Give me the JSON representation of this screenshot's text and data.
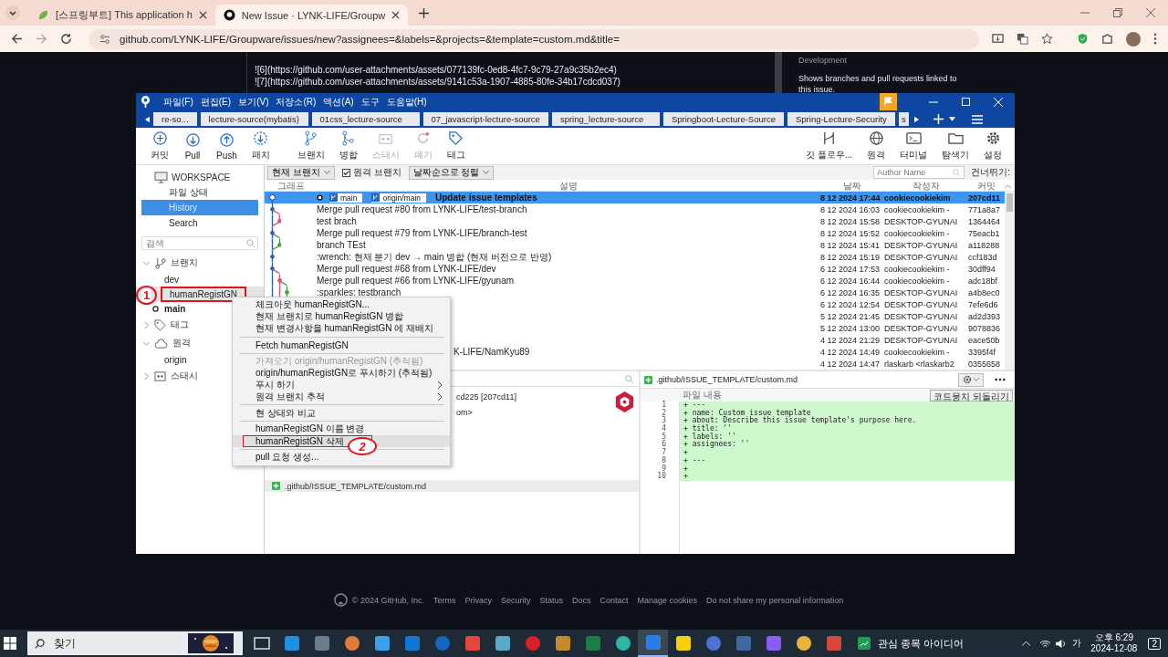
{
  "browser": {
    "tabs": [
      {
        "title": "[스프링부트] This application h",
        "selected": false
      },
      {
        "title": "New Issue · LYNK-LIFE/Groupw",
        "selected": true
      }
    ],
    "url": "github.com/LYNK-LIFE/Groupware/issues/new?assignees=&labels=&projects=&template=custom.md&title="
  },
  "page": {
    "lines": [
      "![6](https://github.com/user-attachments/assets/077139fc-0ed8-4fc7-9c79-27a9c35b2ec4)",
      "![7](https://github.com/user-attachments/assets/9141c53a-1907-4885-80fe-34b17cdcd037)"
    ],
    "sidebar_title": "Development",
    "sidebar_text": "Shows branches and pull requests linked to this issue.",
    "footer": {
      "copyright": "© 2024 GitHub, Inc.",
      "links": [
        "Terms",
        "Privacy",
        "Security",
        "Status",
        "Docs",
        "Contact",
        "Manage cookies",
        "Do not share my personal information"
      ]
    }
  },
  "app": {
    "menu": [
      "파일(F)",
      "편집(E)",
      "보기(V)",
      "저장소(R)",
      "액션(A)",
      "도구",
      "도움말(H)"
    ],
    "repo_tabs": [
      "re-so...",
      "lecture-source(mybatis)",
      "01css_lecture-source",
      "07_javascript-lecture-source",
      "spring_lecture-source",
      "Springboot-Lecture-Source",
      "Spring-Lecture-Security",
      "s"
    ],
    "toolbar_left": [
      {
        "label": "커밋",
        "disabled": false
      },
      {
        "label": "Pull",
        "disabled": false
      },
      {
        "label": "Push",
        "disabled": false
      },
      {
        "label": "패치",
        "disabled": false
      },
      {
        "label": "브랜치",
        "disabled": false
      },
      {
        "label": "병합",
        "disabled": false
      },
      {
        "label": "스태시",
        "disabled": true
      },
      {
        "label": "폐기",
        "disabled": true
      },
      {
        "label": "태그",
        "disabled": false
      }
    ],
    "toolbar_right": [
      {
        "label": "깃 플로우..."
      },
      {
        "label": "원격"
      },
      {
        "label": "터미널"
      },
      {
        "label": "탐색기"
      },
      {
        "label": "설정"
      }
    ],
    "sidebar": {
      "workspace": "WORKSPACE",
      "views": [
        {
          "label": "파일 상태",
          "selected": false
        },
        {
          "label": "History",
          "selected": true
        },
        {
          "label": "Search",
          "selected": false
        }
      ],
      "search_placeholder": "검색",
      "sections": [
        {
          "label": "브랜치",
          "expanded": true,
          "children": [
            {
              "label": "dev",
              "current": false,
              "highlighted": false,
              "annotated": false
            },
            {
              "label": "humanRegistGN",
              "current": false,
              "highlighted": true,
              "annotated": true
            },
            {
              "label": "main",
              "current": true,
              "highlighted": false,
              "annotated": false
            }
          ]
        },
        {
          "label": "태그",
          "expanded": false
        },
        {
          "label": "원격",
          "expanded": true,
          "children": [
            {
              "label": "origin",
              "current": false,
              "highlighted": false,
              "annotated": false
            }
          ]
        },
        {
          "label": "스태시",
          "expanded": false
        }
      ]
    },
    "filters": {
      "branch": "현재 브랜치",
      "remote": {
        "label": "원격 브랜치",
        "checked": true
      },
      "sort": "날짜순으로 정렬",
      "author_placeholder": "Author Name",
      "skip": "건너뛰기:"
    },
    "columns": [
      "그래프",
      "설명",
      "날짜",
      "작성자",
      "커밋"
    ],
    "commits": [
      {
        "refs": [
          "main",
          "origin/main"
        ],
        "message": "Update issue templates",
        "date": "8 12 2024 17:44",
        "author": "cookiecookiekim",
        "hash": "207cd11",
        "selected": true
      },
      {
        "message": "Merge pull request #80 from LYNK-LIFE/test-branch",
        "date": "8 12 2024 16:03",
        "author": "cookiecookiekim -",
        "hash": "771a8a7",
        "selected": false
      },
      {
        "message": "test brach",
        "date": "8 12 2024 15:58",
        "author": "DESKTOP-GYUNAI",
        "hash": "1364464",
        "selected": false
      },
      {
        "message": "Merge pull request #79 from LYNK-LIFE/branch-test",
        "date": "8 12 2024 15:52",
        "author": "cookiecookiekim -",
        "hash": "75eacb1",
        "selected": false
      },
      {
        "message": "branch TEst",
        "date": "8 12 2024 15:41",
        "author": "DESKTOP-GYUNAI",
        "hash": "a118288",
        "selected": false
      },
      {
        "message": ":wrench: 현재 분기 dev → main 병합 (현재 버전으로 반영)",
        "date": "8 12 2024 15:19",
        "author": "DESKTOP-GYUNAI",
        "hash": "ccf183d",
        "selected": false
      },
      {
        "message": "Merge pull request #68 from LYNK-LIFE/dev",
        "date": "6 12 2024 17:53",
        "author": "cookiecookiekim -",
        "hash": "30dff94",
        "selected": false
      },
      {
        "message": "Merge pull request #66 from LYNK-LIFE/gyunam",
        "date": "6 12 2024 16:44",
        "author": "cookiecookiekim -",
        "hash": "adc18bf",
        "selected": false
      },
      {
        "message": ":sparkles: testbranch",
        "date": "6 12 2024 16:35",
        "author": "DESKTOP-GYUNAI",
        "hash": "a4b8ec0",
        "selected": false
      },
      {
        "date": "6 12 2024 12:54",
        "author": "DESKTOP-GYUNAI",
        "hash": "7efe6d6",
        "selected": false
      },
      {
        "date": "5 12 2024 21:45",
        "author": "DESKTOP-GYUNAI",
        "hash": "ad2d393",
        "selected": false
      },
      {
        "date": "5 12 2024 13:00",
        "author": "DESKTOP-GYUNAI",
        "hash": "9078836",
        "selected": false
      },
      {
        "date": "4 12 2024 21:29",
        "author": "DESKTOP-GYUNAI",
        "hash": "eace50b",
        "selected": false
      },
      {
        "message": "K-LIFE/NamKyu89",
        "clipped": true,
        "date": "4 12 2024 14:49",
        "author": "cookiecookiekim -",
        "hash": "3395f4f",
        "selected": false
      },
      {
        "date": "4 12 2024 14:47",
        "author": "rlaskarb <rlaskarb2",
        "hash": "0355658",
        "selected": false
      }
    ],
    "commit_detail": [
      "cd225 [207cd11]",
      "om>"
    ],
    "files": [
      {
        "path": ".github/ISSUE_TEMPLATE/custom.md"
      }
    ],
    "diff": {
      "path": ".github/ISSUE_TEMPLATE/custom.md",
      "section": "파일 내용",
      "revert": "코드뭉치 되돌리기",
      "lines": [
        {
          "no": "1",
          "text": "+ ---"
        },
        {
          "no": "2",
          "text": "+ name: Custom issue template"
        },
        {
          "no": "3",
          "text": "+ about: Describe this issue template's purpose here."
        },
        {
          "no": "4",
          "text": "+ title: ''"
        },
        {
          "no": "5",
          "text": "+ labels: ''"
        },
        {
          "no": "6",
          "text": "+ assignees: ''"
        },
        {
          "no": "7",
          "text": "+"
        },
        {
          "no": "8",
          "text": "+ ---"
        },
        {
          "no": "9",
          "text": "+"
        },
        {
          "no": "10",
          "text": "+"
        }
      ]
    },
    "context_menu": [
      {
        "kind": "item",
        "label": "체크아웃 humanRegistGN...",
        "disabled": false,
        "submenu": false,
        "highlighted": false,
        "annotated": false
      },
      {
        "kind": "item",
        "label": "현재 브랜치로 humanRegistGN 병합",
        "disabled": false,
        "submenu": false,
        "highlighted": false,
        "annotated": false
      },
      {
        "kind": "item",
        "label": "현재 변경사항을 humanRegistGN 에 재배치",
        "disabled": false,
        "submenu": false,
        "highlighted": false,
        "annotated": false
      },
      {
        "kind": "separator"
      },
      {
        "kind": "item",
        "label": "Fetch humanRegistGN",
        "disabled": false,
        "submenu": false,
        "highlighted": false,
        "annotated": false
      },
      {
        "kind": "separator"
      },
      {
        "kind": "item",
        "label": "가져오기 origin/humanRegistGN (추적됨)",
        "disabled": true,
        "submenu": false,
        "highlighted": false,
        "annotated": false
      },
      {
        "kind": "item",
        "label": "origin/humanRegistGN로 푸시하기 (추적됨)",
        "disabled": false,
        "submenu": false,
        "highlighted": false,
        "annotated": false
      },
      {
        "kind": "item",
        "label": "푸시 하기",
        "disabled": false,
        "submenu": true,
        "highlighted": false,
        "annotated": false
      },
      {
        "kind": "item",
        "label": "원격 브랜치 추적",
        "disabled": false,
        "submenu": true,
        "highlighted": false,
        "annotated": false
      },
      {
        "kind": "separator"
      },
      {
        "kind": "item",
        "label": "현 상태와 비교",
        "disabled": false,
        "submenu": false,
        "highlighted": false,
        "annotated": false
      },
      {
        "kind": "separator"
      },
      {
        "kind": "item",
        "label": "humanRegistGN 이름 변경",
        "disabled": false,
        "submenu": false,
        "highlighted": false,
        "annotated": false
      },
      {
        "kind": "item",
        "label": "humanRegistGN 삭제",
        "disabled": false,
        "submenu": false,
        "highlighted": true,
        "annotated": true
      },
      {
        "kind": "separator"
      },
      {
        "kind": "item",
        "label": "pull 요청 생성...",
        "disabled": false,
        "submenu": false,
        "highlighted": false,
        "annotated": false
      }
    ],
    "annotations": [
      {
        "label": "1"
      },
      {
        "label": "2"
      }
    ]
  },
  "taskbar": {
    "search_placeholder": "찾기",
    "apps": [
      {
        "selected": false
      },
      {
        "selected": false
      },
      {
        "selected": false
      },
      {
        "selected": false
      },
      {
        "selected": false
      },
      {
        "selected": false
      },
      {
        "selected": false
      },
      {
        "selected": false
      },
      {
        "selected": false
      },
      {
        "selected": false
      },
      {
        "selected": false
      },
      {
        "selected": false
      },
      {
        "selected": false
      },
      {
        "selected": true
      },
      {
        "selected": false
      },
      {
        "selected": false
      },
      {
        "selected": false
      },
      {
        "selected": false
      },
      {
        "selected": false
      },
      {
        "selected": false
      }
    ],
    "widget": "관심 종목 아이디어",
    "ime": "가",
    "time": "오후 6:29",
    "date": "2024-12-08",
    "notifications": "2"
  }
}
